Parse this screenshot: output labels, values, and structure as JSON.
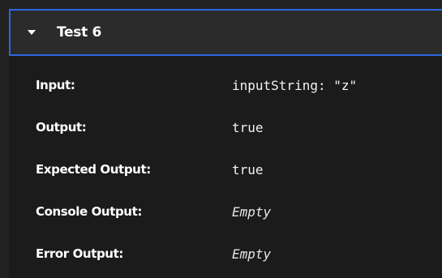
{
  "test": {
    "title": "Test 6",
    "rows": [
      {
        "label": "Input:",
        "value": "inputString: \"z\""
      },
      {
        "label": "Output:",
        "value": "true"
      },
      {
        "label": "Expected Output:",
        "value": "true"
      },
      {
        "label": "Console Output:",
        "value": "Empty"
      },
      {
        "label": "Error Output:",
        "value": "Empty"
      }
    ]
  },
  "colors": {
    "background": "#222222",
    "header_background": "#2b2b2b",
    "header_border": "#2f66e0",
    "text": "#ffffff"
  }
}
